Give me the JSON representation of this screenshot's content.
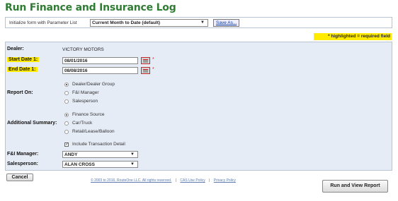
{
  "title": "Run Finance and Insurance Log",
  "param_bar": {
    "label": "Initialize form with Parameter List",
    "selected": "Current Month to Date (default)",
    "save_as": "Save As..."
  },
  "required_note": "* highlighted = required field",
  "form": {
    "dealer_label": "Dealer:",
    "dealer_value": "VICTORY MOTORS",
    "start_label": "Start Date 1:",
    "start_value": "08/01/2016",
    "end_label": "End Date 1:",
    "end_value": "08/08/2016",
    "required_mark": "*",
    "report_on_label": "Report On:",
    "report_on_options": [
      "Dealer/Dealer Group",
      "F&I Manager",
      "Salesperson"
    ],
    "report_on_selected": 0,
    "summary_label": "Additional Summary:",
    "summary_options": [
      "Finance Source",
      "Car/Truck",
      "Retail/Lease/Balloon"
    ],
    "summary_selected": 0,
    "include_detail_label": "Include Transaction Detail",
    "include_detail_checked": true,
    "fi_manager_label": "F&I Manager:",
    "fi_manager_value": "ANDY",
    "salesperson_label": "Salesperson:",
    "salesperson_value": "ALAN CROSS"
  },
  "buttons": {
    "cancel": "Cancel",
    "run": "Run and View Report"
  },
  "footer": {
    "copyright": "© 2003 to 2016, RouteOne LLC. All rights reserved.",
    "cas_policy": "CAS Use Policy",
    "privacy": "Privacy Policy",
    "separator": "|"
  },
  "icons": {
    "calendar": "calendar-icon",
    "dropdown": "chevron-down-icon"
  },
  "colors": {
    "title": "#2e7d32",
    "highlight": "#ffeb00",
    "panel": "#e6ecf6",
    "required": "#c62828"
  }
}
